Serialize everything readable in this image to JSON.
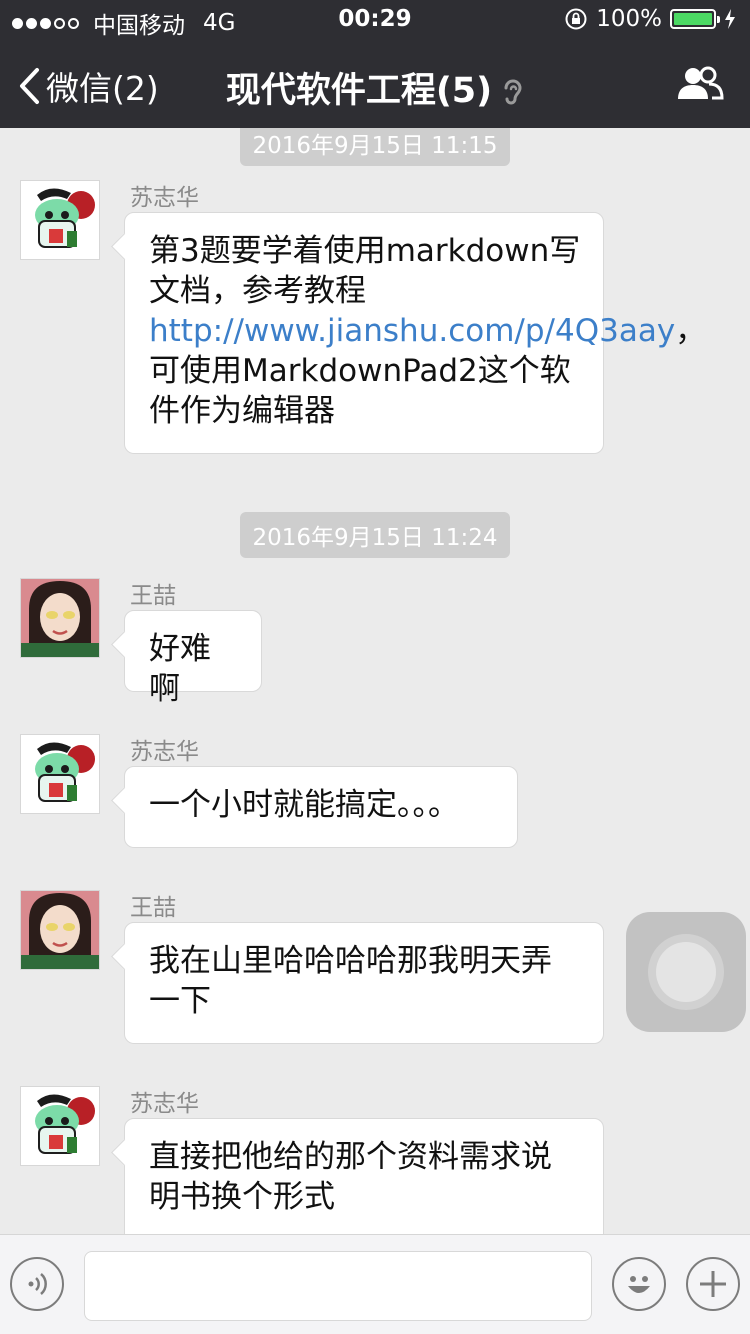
{
  "status_bar": {
    "carrier": "中国移动",
    "network": "4G",
    "time": "00:29",
    "battery": "100%",
    "signal_bars_filled": 3,
    "signal_bars_total": 5,
    "battery_level": 1.0
  },
  "nav": {
    "back_label": "微信(2)",
    "title": "现代软件工程(5)"
  },
  "chat": {
    "timestamps": [
      "2016年9月15日 11:15",
      "2016年9月15日 11:24"
    ],
    "messages": [
      {
        "sender": "苏志华",
        "text_before_link": "第3题要学着使用markdown写文档，参考教程",
        "link": "http://www.jianshu.com/p/4Q3aay",
        "text_after_link": "，可使用MarkdownPad2这个软件作为编辑器"
      },
      {
        "sender": "王喆",
        "text": "好难啊"
      },
      {
        "sender": "苏志华",
        "text": "一个小时就能搞定。。。"
      },
      {
        "sender": "王喆",
        "text": "我在山里哈哈哈哈那我明天弄一下"
      },
      {
        "sender": "苏志华",
        "text": "直接把他给的那个资料需求说明书换个形式"
      }
    ]
  },
  "input_bar": {
    "voice_icon": "voice-icon",
    "emoji_icon": "emoji-icon",
    "plus_icon": "plus-icon",
    "input_value": ""
  },
  "colors": {
    "nav_bg": "#2e2e33",
    "chat_bg": "#ebebeb",
    "link": "#3c7fc9",
    "battery_fill": "#4cd964"
  }
}
